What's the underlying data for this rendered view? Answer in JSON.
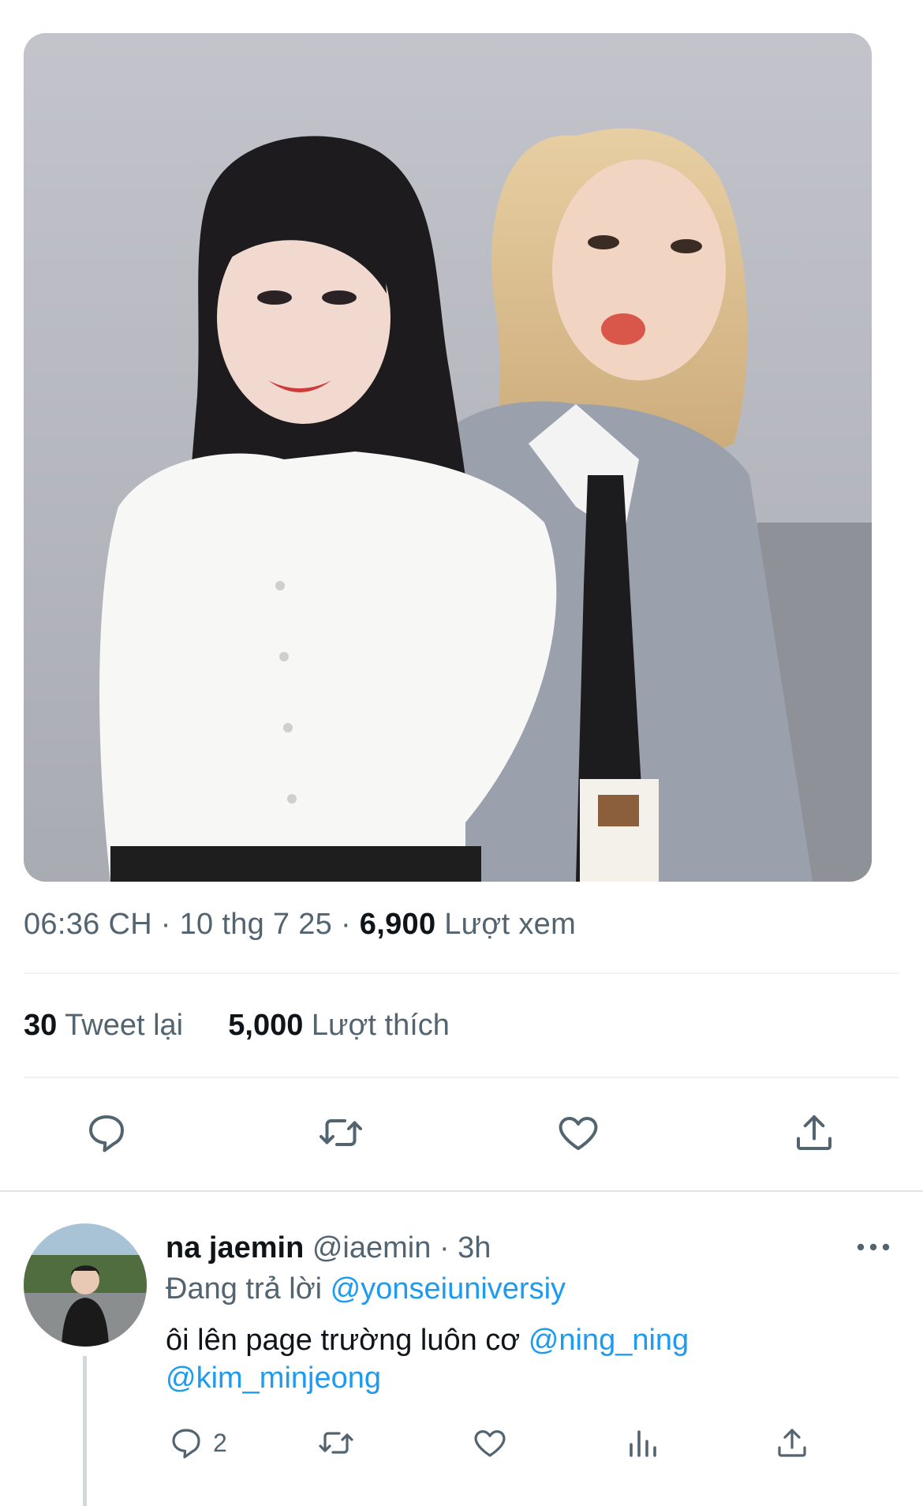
{
  "tweet": {
    "time": "06:36 CH",
    "date": "10 thg 7 25",
    "views_count": "6,900",
    "views_label": "Lượt xem",
    "retweets_count": "30",
    "retweets_label": "Tweet lại",
    "likes_count": "5,000",
    "likes_label": "Lượt thích",
    "separator": "·"
  },
  "reply": {
    "name": "na jaemin",
    "handle": "@iaemin",
    "time": "3h",
    "replying_prefix": "Đang trả lời",
    "replying_to": "@yonseiuniversiy",
    "text": "ôi lên page trường luôn cơ",
    "mention_1": "@ning_ning",
    "mention_2": "@kim_minjeong",
    "reply_count": "2"
  },
  "icons": {
    "reply": "comment-icon",
    "retweet": "retweet-icon",
    "like": "heart-icon",
    "share": "share-icon",
    "views": "analytics-icon",
    "more": "more-icon"
  },
  "colors": {
    "text": "#0f1419",
    "secondary": "#536471",
    "link": "#1d9bf0",
    "divider": "#eff3f4"
  }
}
